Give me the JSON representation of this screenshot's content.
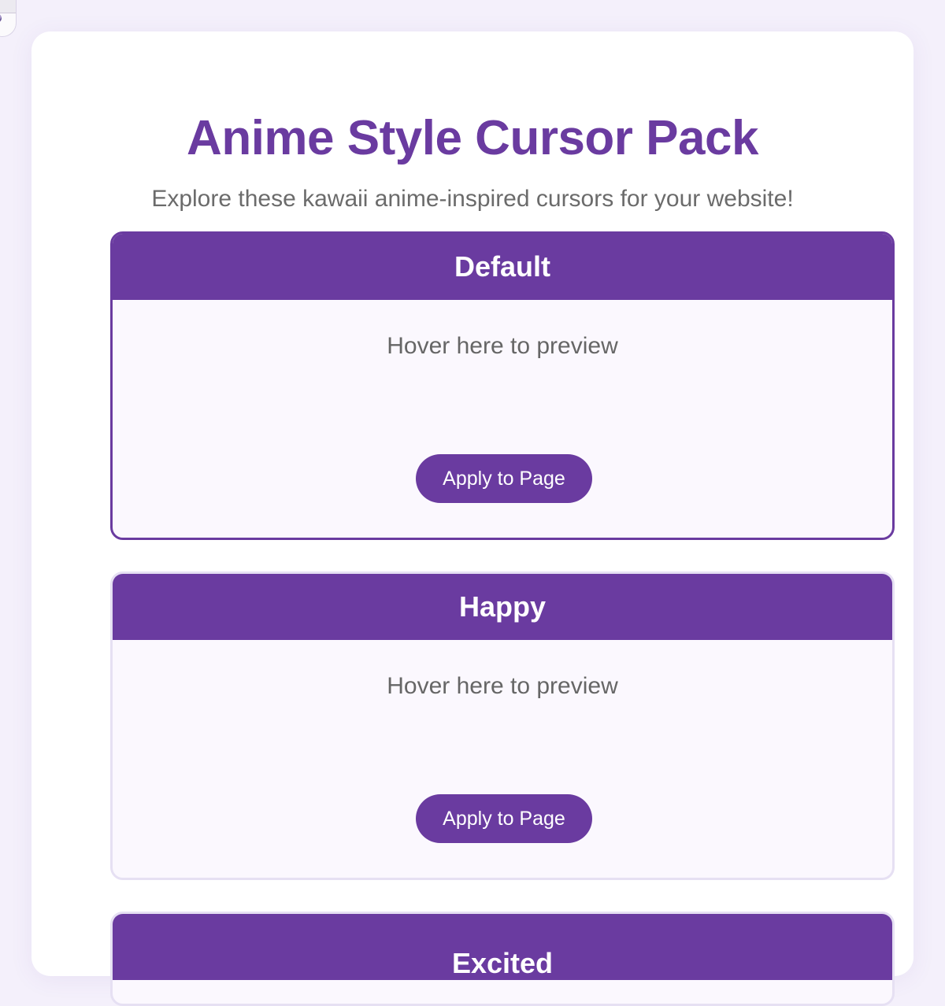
{
  "page": {
    "title": "Anime Style Cursor Pack",
    "subtitle": "Explore these kawaii anime-inspired cursors for your website!"
  },
  "colors": {
    "accent": "#6a3ba0",
    "background": "#f4f0fb",
    "card_border": "#e6e0f3",
    "preview_bg": "#fbf8fe"
  },
  "cursors": [
    {
      "name": "Default",
      "preview_text": "Hover here to preview",
      "button_label": "Apply to Page",
      "active": true
    },
    {
      "name": "Happy",
      "preview_text": "Hover here to preview",
      "button_label": "Apply to Page",
      "active": false
    },
    {
      "name": "Excited"
    }
  ]
}
